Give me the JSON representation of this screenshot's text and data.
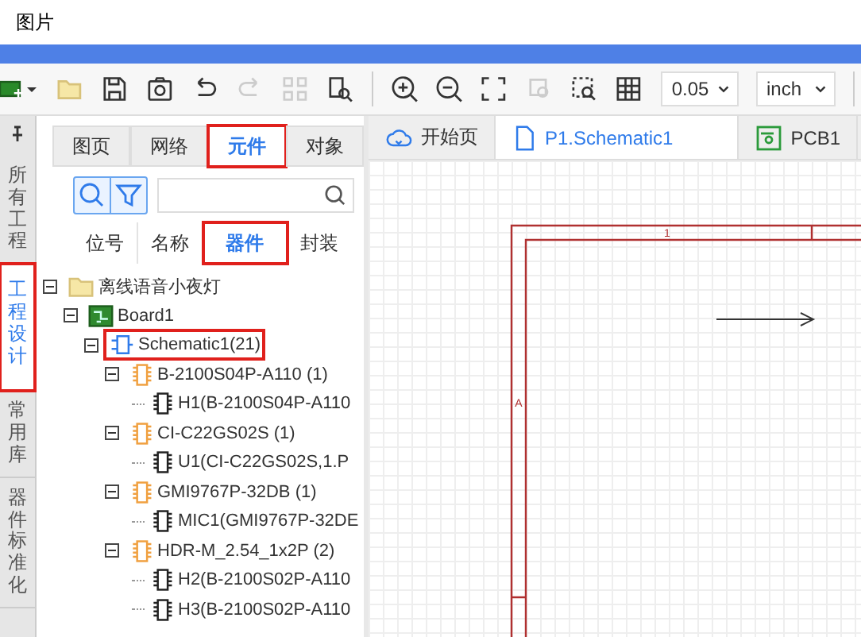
{
  "header": {
    "title": "图片"
  },
  "toolbar": {
    "snap_value": "0.05",
    "unit": "inch"
  },
  "side_tabs": [
    {
      "label": "所有工程",
      "selected": false,
      "highlighted": false
    },
    {
      "label": "工程设计",
      "selected": true,
      "highlighted": true
    },
    {
      "label": "常用库",
      "selected": false,
      "highlighted": false
    },
    {
      "label": "器件标准化",
      "selected": false,
      "highlighted": false
    }
  ],
  "panel": {
    "tabs": [
      {
        "label": "图页",
        "selected": false,
        "highlighted": false
      },
      {
        "label": "网络",
        "selected": false,
        "highlighted": false
      },
      {
        "label": "元件",
        "selected": true,
        "highlighted": true
      },
      {
        "label": "对象",
        "selected": false,
        "highlighted": false
      }
    ],
    "filter_tabs": [
      {
        "label": "位号",
        "selected": false,
        "highlighted": false
      },
      {
        "label": "名称",
        "selected": false,
        "highlighted": false
      },
      {
        "label": "器件",
        "selected": true,
        "highlighted": true
      },
      {
        "label": "封装",
        "selected": false,
        "highlighted": false
      }
    ],
    "tree": [
      {
        "label": "离线语音小夜灯",
        "kind": "folder",
        "expanded": true,
        "highlighted": false,
        "children": [
          {
            "label": "Board1",
            "kind": "board",
            "expanded": true,
            "highlighted": false,
            "children": [
              {
                "label": "Schematic1(21)",
                "kind": "schematic",
                "expanded": true,
                "highlighted": true,
                "children": [
                  {
                    "label": "B-2100S04P-A110 (1)",
                    "kind": "component",
                    "expanded": true,
                    "highlighted": false,
                    "children": [
                      {
                        "label": "H1(B-2100S04P-A110",
                        "kind": "part",
                        "highlighted": false
                      }
                    ]
                  },
                  {
                    "label": "CI-C22GS02S (1)",
                    "kind": "component",
                    "expanded": true,
                    "highlighted": false,
                    "children": [
                      {
                        "label": "U1(CI-C22GS02S,1.P",
                        "kind": "part",
                        "highlighted": false
                      }
                    ]
                  },
                  {
                    "label": "GMI9767P-32DB (1)",
                    "kind": "component",
                    "expanded": true,
                    "highlighted": false,
                    "children": [
                      {
                        "label": "MIC1(GMI9767P-32DE",
                        "kind": "part",
                        "highlighted": false
                      }
                    ]
                  },
                  {
                    "label": "HDR-M_2.54_1x2P (2)",
                    "kind": "component",
                    "expanded": true,
                    "highlighted": false,
                    "children": [
                      {
                        "label": "H2(B-2100S02P-A110",
                        "kind": "part",
                        "highlighted": false
                      },
                      {
                        "label": "H3(B-2100S02P-A110",
                        "kind": "part",
                        "highlighted": false
                      }
                    ]
                  }
                ]
              }
            ]
          }
        ]
      }
    ]
  },
  "doc_tabs": [
    {
      "label": "开始页",
      "kind": "home",
      "selected": false
    },
    {
      "label": "P1.Schematic1",
      "kind": "schematic",
      "selected": true
    },
    {
      "label": "PCB1",
      "kind": "pcb",
      "selected": false
    }
  ],
  "canvas": {
    "frame_column": "1",
    "frame_row": "A"
  }
}
